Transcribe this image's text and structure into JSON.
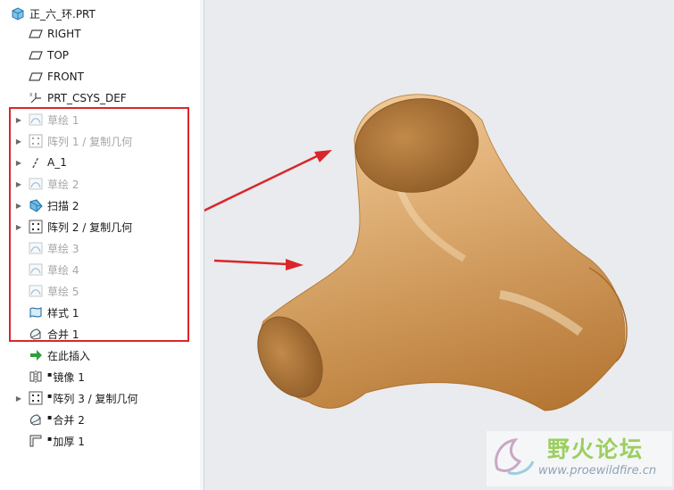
{
  "tree": {
    "root": "正_六_环.PRT",
    "items": [
      {
        "label": "RIGHT",
        "icon": "datum-plane-icon",
        "expandable": false,
        "dim": false
      },
      {
        "label": "TOP",
        "icon": "datum-plane-icon",
        "expandable": false,
        "dim": false
      },
      {
        "label": "FRONT",
        "icon": "datum-plane-icon",
        "expandable": false,
        "dim": false
      },
      {
        "label": "PRT_CSYS_DEF",
        "icon": "csys-icon",
        "expandable": false,
        "dim": false
      },
      {
        "label": "草绘 1",
        "icon": "sketch-icon",
        "expandable": true,
        "dim": true
      },
      {
        "label": "阵列 1 / 复制几何",
        "icon": "pattern-icon",
        "expandable": true,
        "dim": true
      },
      {
        "label": "A_1",
        "icon": "datum-axis-icon",
        "expandable": true,
        "dim": false
      },
      {
        "label": "草绘 2",
        "icon": "sketch-icon",
        "expandable": true,
        "dim": true
      },
      {
        "label": "扫描 2",
        "icon": "sweep-icon",
        "expandable": true,
        "dim": false
      },
      {
        "label": "阵列 2 / 复制几何",
        "icon": "pattern-icon",
        "expandable": true,
        "dim": false
      },
      {
        "label": "草绘 3",
        "icon": "sketch-icon",
        "expandable": false,
        "dim": true
      },
      {
        "label": "草绘 4",
        "icon": "sketch-icon",
        "expandable": false,
        "dim": true
      },
      {
        "label": "草绘 5",
        "icon": "sketch-icon",
        "expandable": false,
        "dim": true
      },
      {
        "label": "样式 1",
        "icon": "style-icon",
        "expandable": false,
        "dim": false
      },
      {
        "label": "合并 1",
        "icon": "merge-icon",
        "expandable": false,
        "dim": false
      },
      {
        "label": "在此插入",
        "icon": "insert-here-icon",
        "expandable": false,
        "dim": false
      },
      {
        "label": "镜像 1",
        "icon": "mirror-icon",
        "expandable": false,
        "dim": false
      },
      {
        "label": "阵列 3 / 复制几何",
        "icon": "pattern-icon",
        "expandable": true,
        "dim": false
      },
      {
        "label": "合并 2",
        "icon": "merge-icon",
        "expandable": false,
        "dim": false
      },
      {
        "label": "加厚 1",
        "icon": "thicken-icon",
        "expandable": false,
        "dim": false
      }
    ]
  },
  "watermark": {
    "name": "野火论坛",
    "url": "www.proewildfire.cn"
  },
  "colors": {
    "highlight": "#d9262b",
    "arrow": "#d9262b",
    "part": "#e2a55c",
    "viewport": "#e9ebee"
  }
}
